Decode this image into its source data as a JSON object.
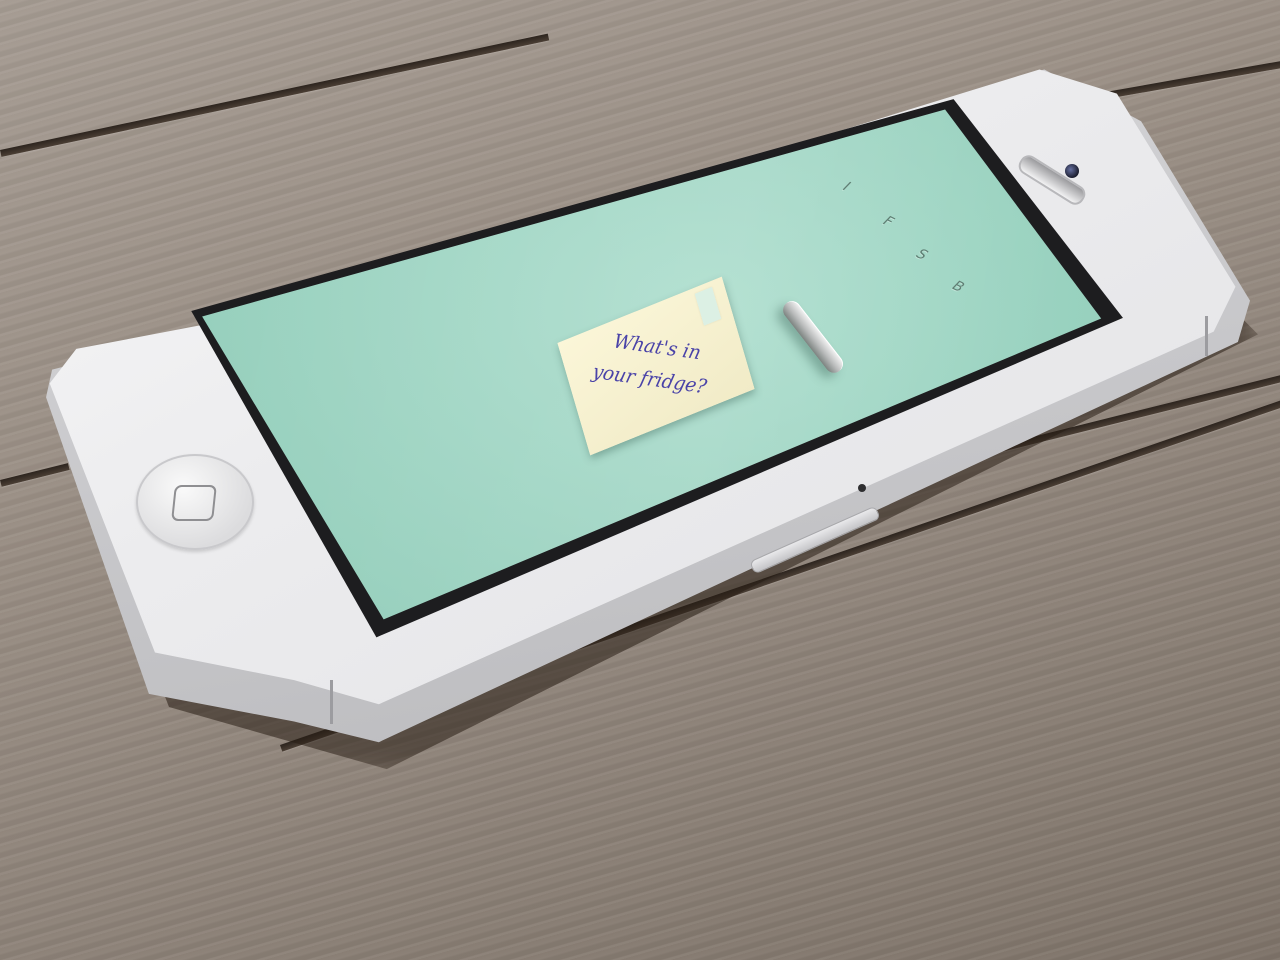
{
  "app": {
    "menu_letters": [
      "I",
      "F",
      "S",
      "B"
    ],
    "note_text": "What's in your fridge?",
    "screen_color": "#96d0bd",
    "note_color": "#f7f1cf",
    "ink_color": "#4a43a8"
  },
  "device": {
    "color": "white",
    "surface": "wooden table"
  }
}
